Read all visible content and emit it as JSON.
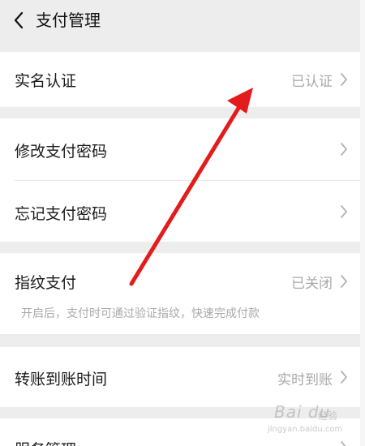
{
  "header": {
    "back_icon": "chevron-left-icon",
    "title": "支付管理"
  },
  "items": {
    "real_name": {
      "label": "实名认证",
      "value": "已认证"
    },
    "change_password": {
      "label": "修改支付密码"
    },
    "forgot_password": {
      "label": "忘记支付密码"
    },
    "fingerprint": {
      "label": "指纹支付",
      "value": "已关闭",
      "description": "开启后，支付时可通过验证指纹，快速完成付款"
    },
    "transfer_time": {
      "label": "转账到账时间",
      "value": "实时到账"
    },
    "service_management": {
      "label": "服务管理"
    }
  },
  "annotation": {
    "type": "arrow",
    "color": "#e31b1b"
  },
  "watermark": {
    "brand": "Bai du",
    "sub": "经验",
    "url": "jingyan.baidu.com"
  }
}
